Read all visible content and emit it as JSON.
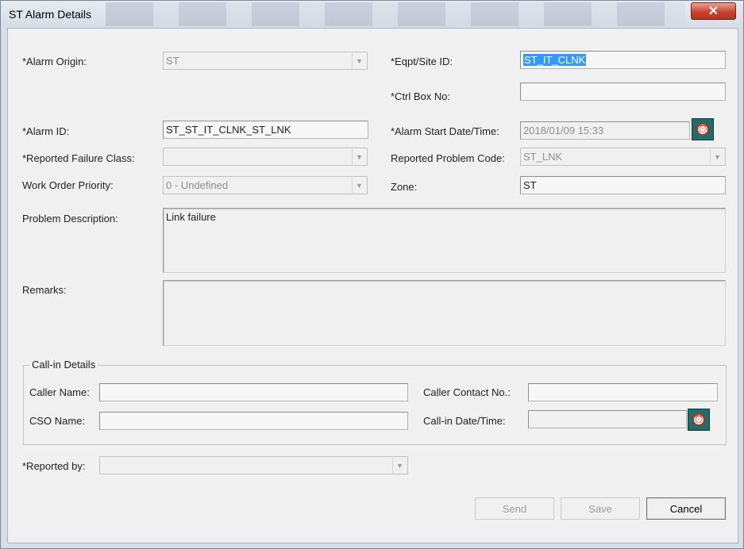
{
  "window": {
    "title": "ST Alarm Details",
    "close_label": "✕"
  },
  "form": {
    "alarm_origin": {
      "label": "*Alarm Origin:",
      "value": "ST"
    },
    "eqpt_site_id": {
      "label": "*Eqpt/Site ID:",
      "value": "ST_IT_CLNK"
    },
    "ctrl_box_no": {
      "label": "*Ctrl Box No:",
      "value": ""
    },
    "alarm_id": {
      "label": "*Alarm ID:",
      "value": "ST_ST_IT_CLNK_ST_LNK"
    },
    "alarm_start": {
      "label": "*Alarm Start Date/Time:",
      "value": "2018/01/09  15:33"
    },
    "reported_failure_class": {
      "label": "*Reported Failure Class:",
      "value": ""
    },
    "reported_problem_code": {
      "label": "Reported Problem Code:",
      "value": "ST_LNK"
    },
    "work_order_priority": {
      "label": "Work Order Priority:",
      "value": "0 - Undefined"
    },
    "zone": {
      "label": "Zone:",
      "value": "ST"
    },
    "problem_description": {
      "label": "Problem Description:",
      "value": "Link failure"
    },
    "remarks": {
      "label": "Remarks:",
      "value": ""
    }
  },
  "callin": {
    "title": "Call-in Details",
    "caller_name": {
      "label": "Caller Name:",
      "value": ""
    },
    "caller_contact": {
      "label": "Caller Contact No.:",
      "value": ""
    },
    "cso_name": {
      "label": "CSO Name:",
      "value": ""
    },
    "callin_datetime": {
      "label": "Call-in Date/Time:",
      "value": ""
    }
  },
  "reported_by": {
    "label": "*Reported by:",
    "value": ""
  },
  "buttons": {
    "send": "Send",
    "save": "Save",
    "cancel": "Cancel"
  },
  "icons": {
    "calendar": "alarm-clock-icon",
    "dropdown": "chevron-down-icon",
    "close": "close-icon"
  },
  "colors": {
    "close_button": "#c9442f",
    "calendar_button": "#1e6e6a",
    "selection": "#3399ff"
  }
}
